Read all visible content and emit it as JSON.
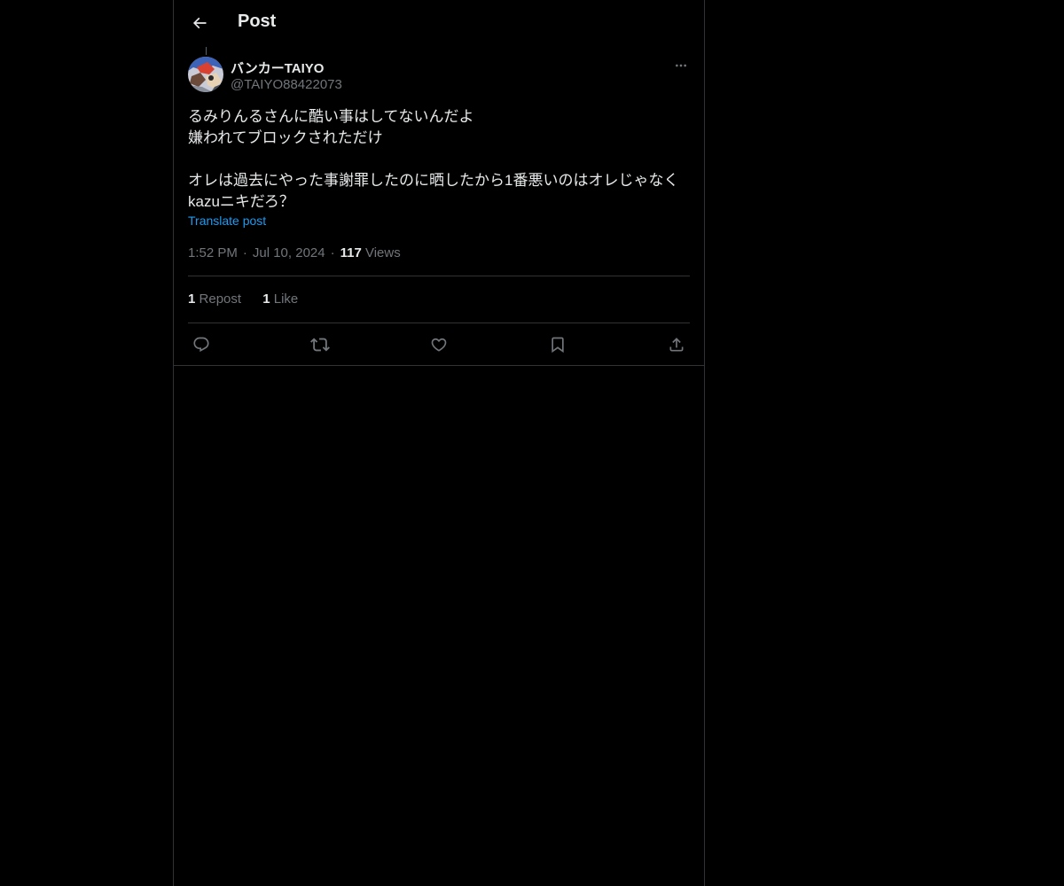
{
  "header": {
    "title": "Post"
  },
  "post": {
    "author": {
      "display_name": "バンカーTAIYO",
      "handle": "@TAIYO88422073"
    },
    "text": "るみりんるさんに酷い事はしてないんだよ\n嫌われてブロックされただけ\n\nオレは過去にやった事謝罪したのに晒したから1番悪いのはオレじゃなく\nkazuニキだろ？",
    "translate_label": "Translate post",
    "time": "1:52 PM",
    "date": "Jul 10, 2024",
    "views_count": "117",
    "views_label": "Views",
    "reposts_count": "1",
    "reposts_label": "Repost",
    "likes_count": "1",
    "likes_label": "Like"
  },
  "colors": {
    "background": "#000000",
    "text": "#e7e9ea",
    "secondary": "#71767b",
    "accent": "#1d9bf0",
    "border": "#2f3336"
  },
  "icons": {
    "back": "arrow-left-icon",
    "more": "more-horizontal-icon",
    "reply": "reply-icon",
    "repost": "repost-icon",
    "like": "heart-icon",
    "bookmark": "bookmark-icon",
    "share": "share-icon"
  }
}
